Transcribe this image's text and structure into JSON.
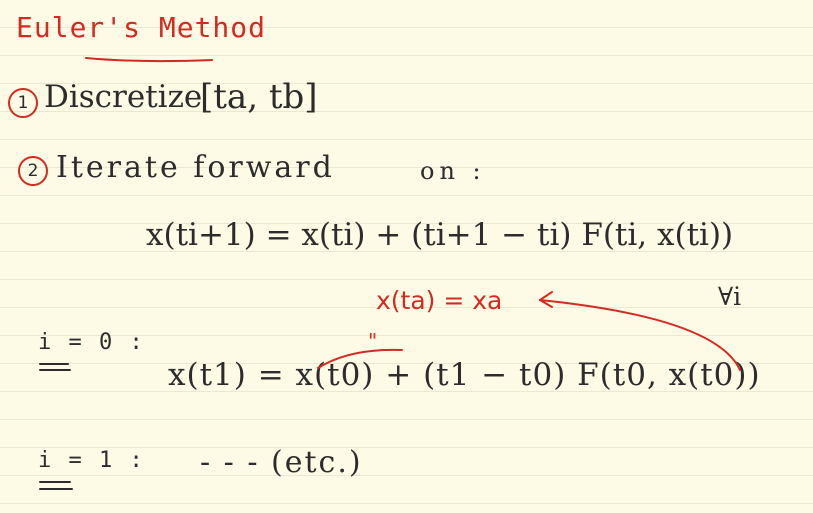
{
  "title": "Euler's Method",
  "step1": {
    "number": "1",
    "text": "Discretize",
    "interval": "[ta, tb]"
  },
  "step2": {
    "number": "2",
    "text": "Iterate forward",
    "suffix": "on :"
  },
  "update_equation": "x(ti+1) = x(ti) + (ti+1 − ti) F(ti, x(ti))",
  "for_all": "∀i",
  "initial_condition": "x(ta) = xa",
  "equals_mark": "\"",
  "case_0": {
    "label": "i = 0 :",
    "equation": "x(t1) = x(t0) + (t1 − t0) F(t0, x(t0))"
  },
  "case_1": {
    "label": "i = 1 :",
    "ellipsis": "- - -",
    "text": "(etc.)"
  },
  "colors": {
    "paper": "#fdfbe6",
    "rule_line": "#ece8cf",
    "ink": "#2d2b2b",
    "accent": "#d42a22"
  }
}
